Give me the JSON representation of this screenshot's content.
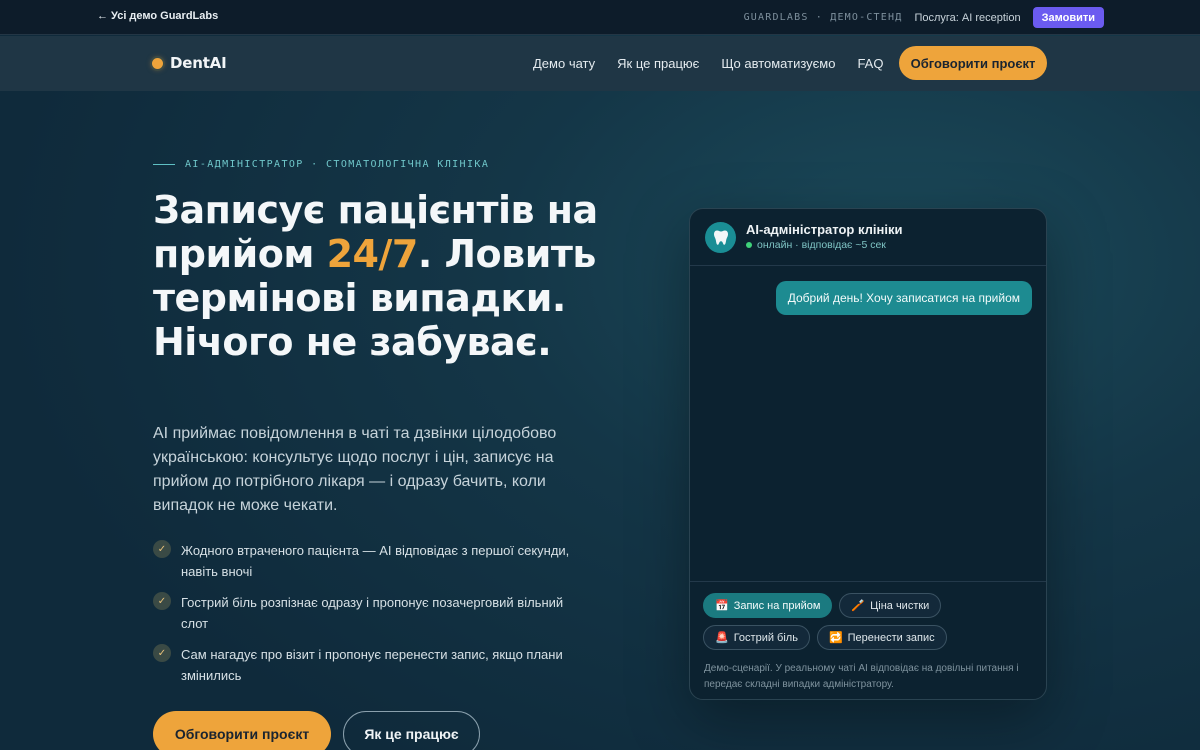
{
  "topbar": {
    "back_label": "← Усі демо GuardLabs",
    "brand_tag": "GUARDLABS · ДЕМО-СТЕНД",
    "service_label": "Послуга: AI reception",
    "order_label": "Замовити"
  },
  "header": {
    "logo_text": "DentAI",
    "nav": [
      "Демо чату",
      "Як це працює",
      "Що автоматизуємо",
      "FAQ"
    ],
    "cta_label": "Обговорити проєкт"
  },
  "hero": {
    "eyebrow": "AI-АДМІНІСТРАТОР · СТОМАТОЛОГІЧНА КЛІНІКА",
    "title_part1": "Записує пацієнтів на прийом ",
    "title_accent": "24/7",
    "title_part2": ". Ловить термінові випадки. Нічого не забуває.",
    "subtitle": "AI приймає повідомлення в чаті та дзвінки цілодобово українською: консультує щодо послуг і цін, записує на прийом до потрібного лікаря — і одразу бачить, коли випадок не може чекати.",
    "features": [
      "Жодного втраченого пацієнта — AI відповідає з першої секунди, навіть вночі",
      "Гострий біль розпізнає одразу і пропонує позачерговий вільний слот",
      "Сам нагадує про візит і пропонує перенести запис, якщо плани змінились"
    ],
    "primary_button": "Обговорити проєкт",
    "secondary_button": "Як це працює"
  },
  "chat": {
    "title": "AI-адміністратор клініки",
    "status": "онлайн · відповідає ~5 сек",
    "messages": [
      {
        "from": "user",
        "text": "Добрий день! Хочу записатися на прийом"
      }
    ],
    "chips": [
      {
        "icon": "📅",
        "icon_name": "calendar-icon",
        "label": "Запис на прийом",
        "active": true
      },
      {
        "icon": "🪥",
        "icon_name": "toothbrush-icon",
        "label": "Ціна чистки",
        "active": false
      },
      {
        "icon": "🚨",
        "icon_name": "siren-icon",
        "label": "Гострий біль",
        "active": false
      },
      {
        "icon": "🔁",
        "icon_name": "repeat-icon",
        "label": "Перенести запис",
        "active": false
      }
    ],
    "note": "Демо-сценарії. У реальному чаті AI відповідає на довільні питання і передає складні випадки адміністратору."
  },
  "colors": {
    "accent": "#eea43b",
    "teal": "#1d8b91",
    "order_button": "#6b5bf0",
    "online": "#3fd27a"
  }
}
